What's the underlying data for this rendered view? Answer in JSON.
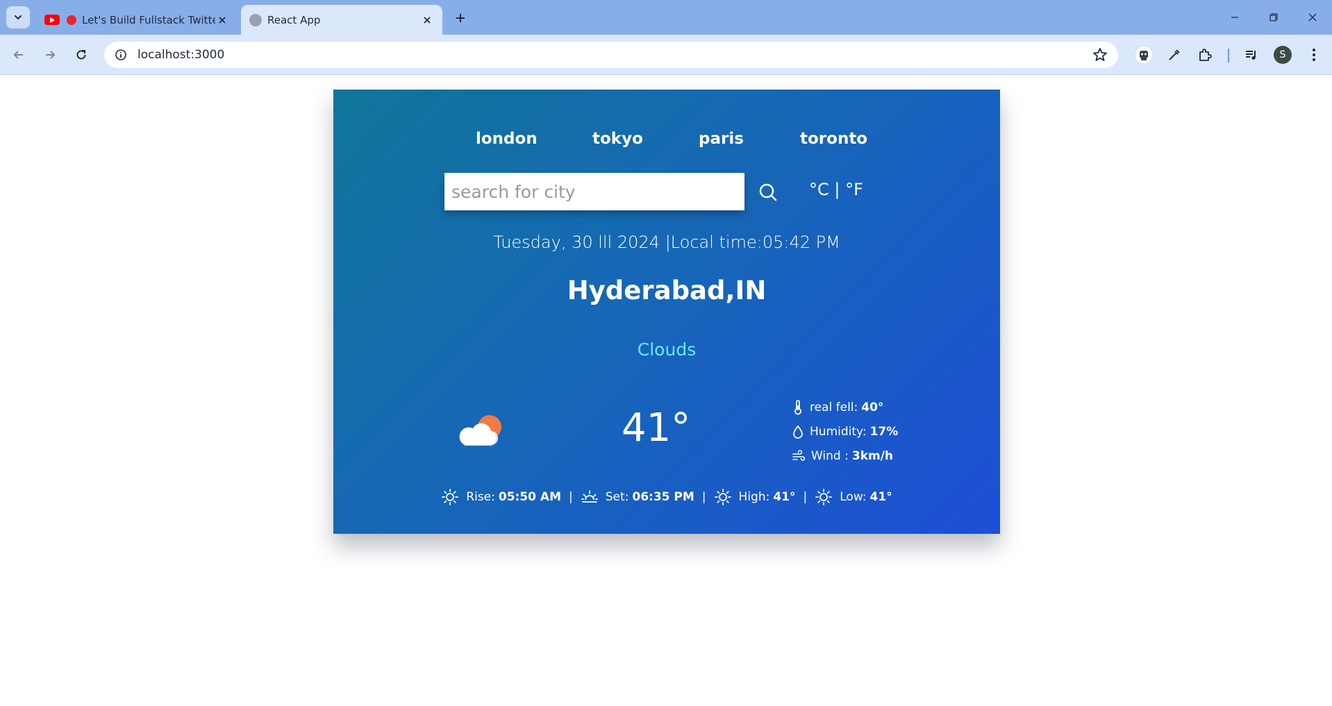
{
  "browser": {
    "tabs": [
      {
        "title": "Let's Build Fullstack Twitter"
      },
      {
        "title": "React App"
      }
    ],
    "url": "localhost:3000",
    "profile_initial": "S"
  },
  "weather": {
    "cities": [
      "london",
      "tokyo",
      "paris",
      "toronto"
    ],
    "search_placeholder": "search for city",
    "search_value": "",
    "units_label": "°C | °F",
    "datetime": "Tuesday, 30 lll 2024 |Local time:05:42 PM",
    "location": "Hyderabad,IN",
    "condition": "Clouds",
    "temperature": "41°",
    "details": {
      "real_feel_label": "real fell:",
      "real_feel_value": "40°",
      "humidity_label": "Humidity:",
      "humidity_value": "17%",
      "wind_label": "Wind :",
      "wind_value": "3km/h"
    },
    "sun": {
      "rise_label": "Rise:",
      "rise_value": "05:50 AM",
      "set_label": "Set:",
      "set_value": "06:35 PM",
      "high_label": "High:",
      "high_value": "41°",
      "low_label": "Low:",
      "low_value": "41°",
      "separator": "|"
    }
  },
  "colors": {
    "card_gradient_start": "#10759a",
    "card_gradient_end": "#1d4fd6",
    "condition_text": "#67e8f9",
    "tab_strip": "#88aee9"
  }
}
